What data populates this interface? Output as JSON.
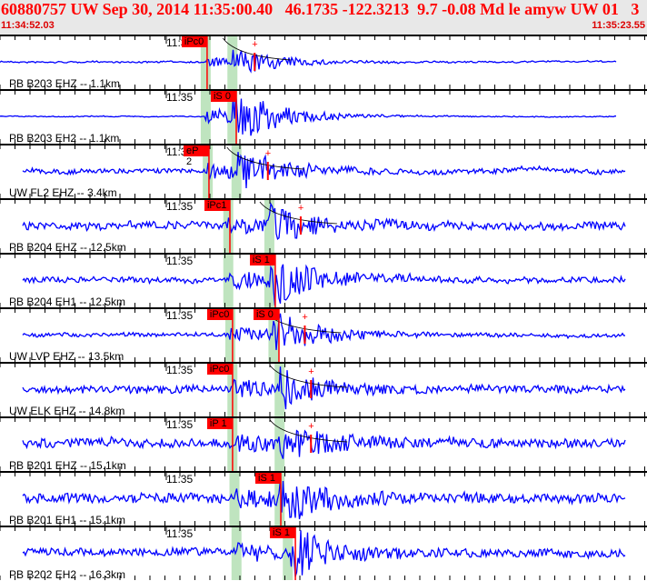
{
  "header": {
    "title": "60880757 UW Sep 30, 2014 11:35:00.40   46.1735 -122.3213  9.7 -0.08 Md le amyw UW 01   3",
    "window_start": "11:34:52.03",
    "window_end": "11:35:23.55",
    "window_seconds": 31.52
  },
  "colors": {
    "trace": "#0000ff",
    "pick": "#ff0000",
    "window": "#bfe4bf",
    "header_bg": "#e8e8e8"
  },
  "time_label": "11:35",
  "panels": [
    {
      "station": "PB B203 EHZ -- 1.1km",
      "picks": [
        {
          "label": "iPc0",
          "t": 10.09
        }
      ],
      "p": 10.0,
      "s": 11.3,
      "coda": true
    },
    {
      "station": "PB B203 EH2 -- 1.1km",
      "picks": [
        {
          "label": "iS 0",
          "t": 11.51
        }
      ],
      "p": 10.0,
      "s": 11.3,
      "coda": false
    },
    {
      "station": "UW FL2 EHZ -- 3.4km",
      "picks": [
        {
          "label": "eP 2",
          "t": 10.18
        }
      ],
      "p": 10.1,
      "s": 11.5,
      "coda": true
    },
    {
      "station": "PB B204 EHZ -- 12.5km",
      "picks": [
        {
          "label": "iPc1",
          "t": 11.2
        }
      ],
      "p": 11.1,
      "s": 13.1,
      "coda": true
    },
    {
      "station": "PB B204 EH1 -- 12.5km",
      "picks": [
        {
          "label": "iS 1",
          "t": 13.41
        }
      ],
      "p": 11.1,
      "s": 13.1,
      "coda": false
    },
    {
      "station": "UW LVP EHZ -- 13.5km",
      "picks": [
        {
          "label": "iPc0",
          "t": 11.33
        },
        {
          "label": "iS 0",
          "t": 13.59
        }
      ],
      "p": 11.2,
      "s": 13.3,
      "coda": true
    },
    {
      "station": "UW ELK EHZ -- 14.8km",
      "picks": [
        {
          "label": "iPc0",
          "t": 11.33
        }
      ],
      "p": 11.3,
      "s": 13.6,
      "coda": true
    },
    {
      "station": "PB B201 EHZ -- 15.1km",
      "picks": [
        {
          "label": "iP 1",
          "t": 11.33
        }
      ],
      "p": 11.3,
      "s": 13.6,
      "coda": true
    },
    {
      "station": "PB B201 EH1 -- 15.1km",
      "picks": [
        {
          "label": "iS 1",
          "t": 13.68
        }
      ],
      "p": 11.4,
      "s": 13.6,
      "coda": false
    },
    {
      "station": "PB B202 EH2 -- 16.3km",
      "picks": [
        {
          "label": "iS 1",
          "t": 14.39
        }
      ],
      "p": 11.5,
      "s": 14.0,
      "coda": false
    }
  ]
}
